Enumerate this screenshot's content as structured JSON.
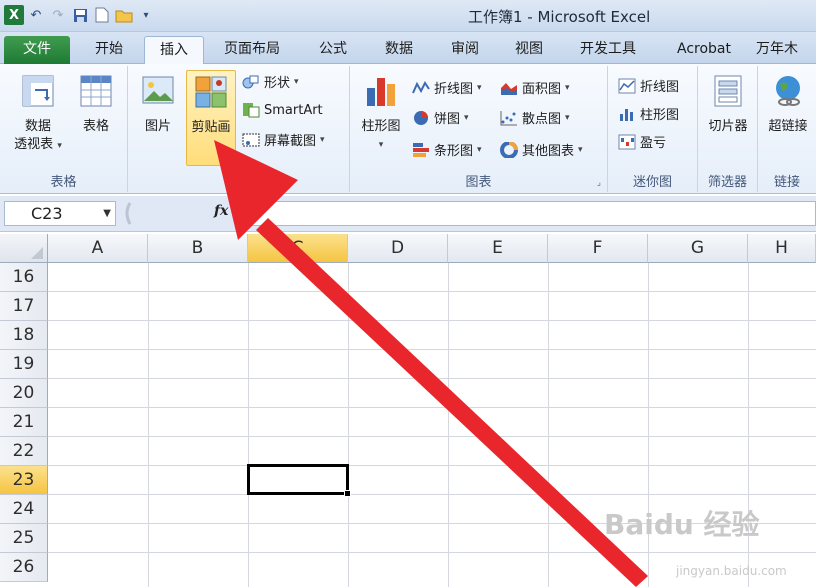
{
  "window": {
    "title": "工作簿1 - Microsoft Excel"
  },
  "quick_access": [
    {
      "name": "excel-logo",
      "glyph": "X"
    },
    {
      "name": "undo-icon",
      "glyph": "↶"
    },
    {
      "name": "redo-icon",
      "glyph": "↷"
    },
    {
      "name": "save-icon",
      "glyph": "▣"
    },
    {
      "name": "new-file-icon",
      "glyph": "▯"
    },
    {
      "name": "open-folder-icon",
      "glyph": "▰"
    }
  ],
  "tabs": [
    {
      "label": "文件",
      "key": "file"
    },
    {
      "label": "开始",
      "key": "home"
    },
    {
      "label": "插入",
      "key": "insert",
      "active": true
    },
    {
      "label": "页面布局",
      "key": "page-layout"
    },
    {
      "label": "公式",
      "key": "formulas"
    },
    {
      "label": "数据",
      "key": "data"
    },
    {
      "label": "审阅",
      "key": "review"
    },
    {
      "label": "视图",
      "key": "view"
    },
    {
      "label": "开发工具",
      "key": "developer"
    },
    {
      "label": "Acrobat",
      "key": "acrobat"
    },
    {
      "label": "万年木",
      "key": "wannianmu"
    }
  ],
  "ribbon": {
    "tables": {
      "label": "表格",
      "pivot_line1": "数据",
      "pivot_line2": "透视表",
      "table": "表格"
    },
    "illustrations": {
      "label": "插",
      "picture": "图片",
      "clipart": "剪贴画",
      "shapes": "形状",
      "smartart": "SmartArt",
      "screenshot": "屏幕截图"
    },
    "charts": {
      "label": "图表",
      "column": "柱形图",
      "line": "折线图",
      "pie": "饼图",
      "bar": "条形图",
      "area": "面积图",
      "scatter": "散点图",
      "other": "其他图表"
    },
    "sparklines": {
      "label": "迷你图",
      "line": "折线图",
      "column": "柱形图",
      "winloss": "盈亏"
    },
    "filter": {
      "label": "筛选器",
      "slicer": "切片器"
    },
    "links": {
      "label": "链接",
      "hyperlink": "超链接"
    }
  },
  "formula_bar": {
    "name_box": "C23",
    "fx": "fx",
    "value": ""
  },
  "sheet": {
    "columns": [
      "A",
      "B",
      "C",
      "D",
      "E",
      "F",
      "G",
      "H"
    ],
    "selected_column": "C",
    "rows": [
      "16",
      "17",
      "18",
      "19",
      "20",
      "21",
      "22",
      "23",
      "24",
      "25",
      "26"
    ],
    "selected_row": "23",
    "active_cell": "C23"
  },
  "watermark": {
    "text": "Baidu 经验",
    "sub": "jingyan.baidu.com"
  },
  "colors": {
    "file_tab": "#1f7a34",
    "selection": "#f5c542",
    "arrow": "#e8262b"
  }
}
